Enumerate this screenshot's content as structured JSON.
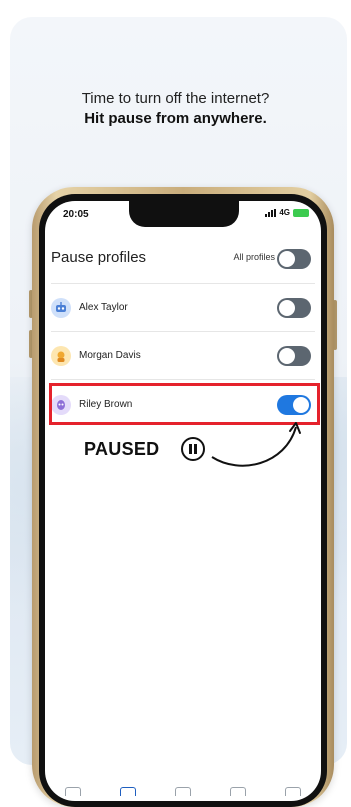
{
  "headline": {
    "line1": "Time to turn off the internet?",
    "line2": "Hit pause from anywhere."
  },
  "status_bar": {
    "time": "20:05",
    "network": "4G"
  },
  "screen": {
    "title": "Pause profiles",
    "all_profiles_label": "All profiles",
    "all_profiles_on": false
  },
  "profiles": [
    {
      "name": "Alex Taylor",
      "icon": "robot-avatar-icon",
      "paused": false,
      "color": "#7aa6e8"
    },
    {
      "name": "Morgan Davis",
      "icon": "character-avatar-icon",
      "paused": false,
      "color": "#f4c04a"
    },
    {
      "name": "Riley Brown",
      "icon": "alien-avatar-icon",
      "paused": true,
      "color": "#8e6fd8"
    }
  ],
  "callout": {
    "label": "PAUSED",
    "icon": "pause-circle-icon",
    "highlight_color": "#e5222c"
  },
  "colors": {
    "toggle_on": "#1f78e0",
    "toggle_off": "#5c6670"
  },
  "tabbar": [
    "home-tab-icon",
    "profiles-tab-icon",
    "devices-tab-icon",
    "schedule-tab-icon",
    "people-tab-icon"
  ]
}
